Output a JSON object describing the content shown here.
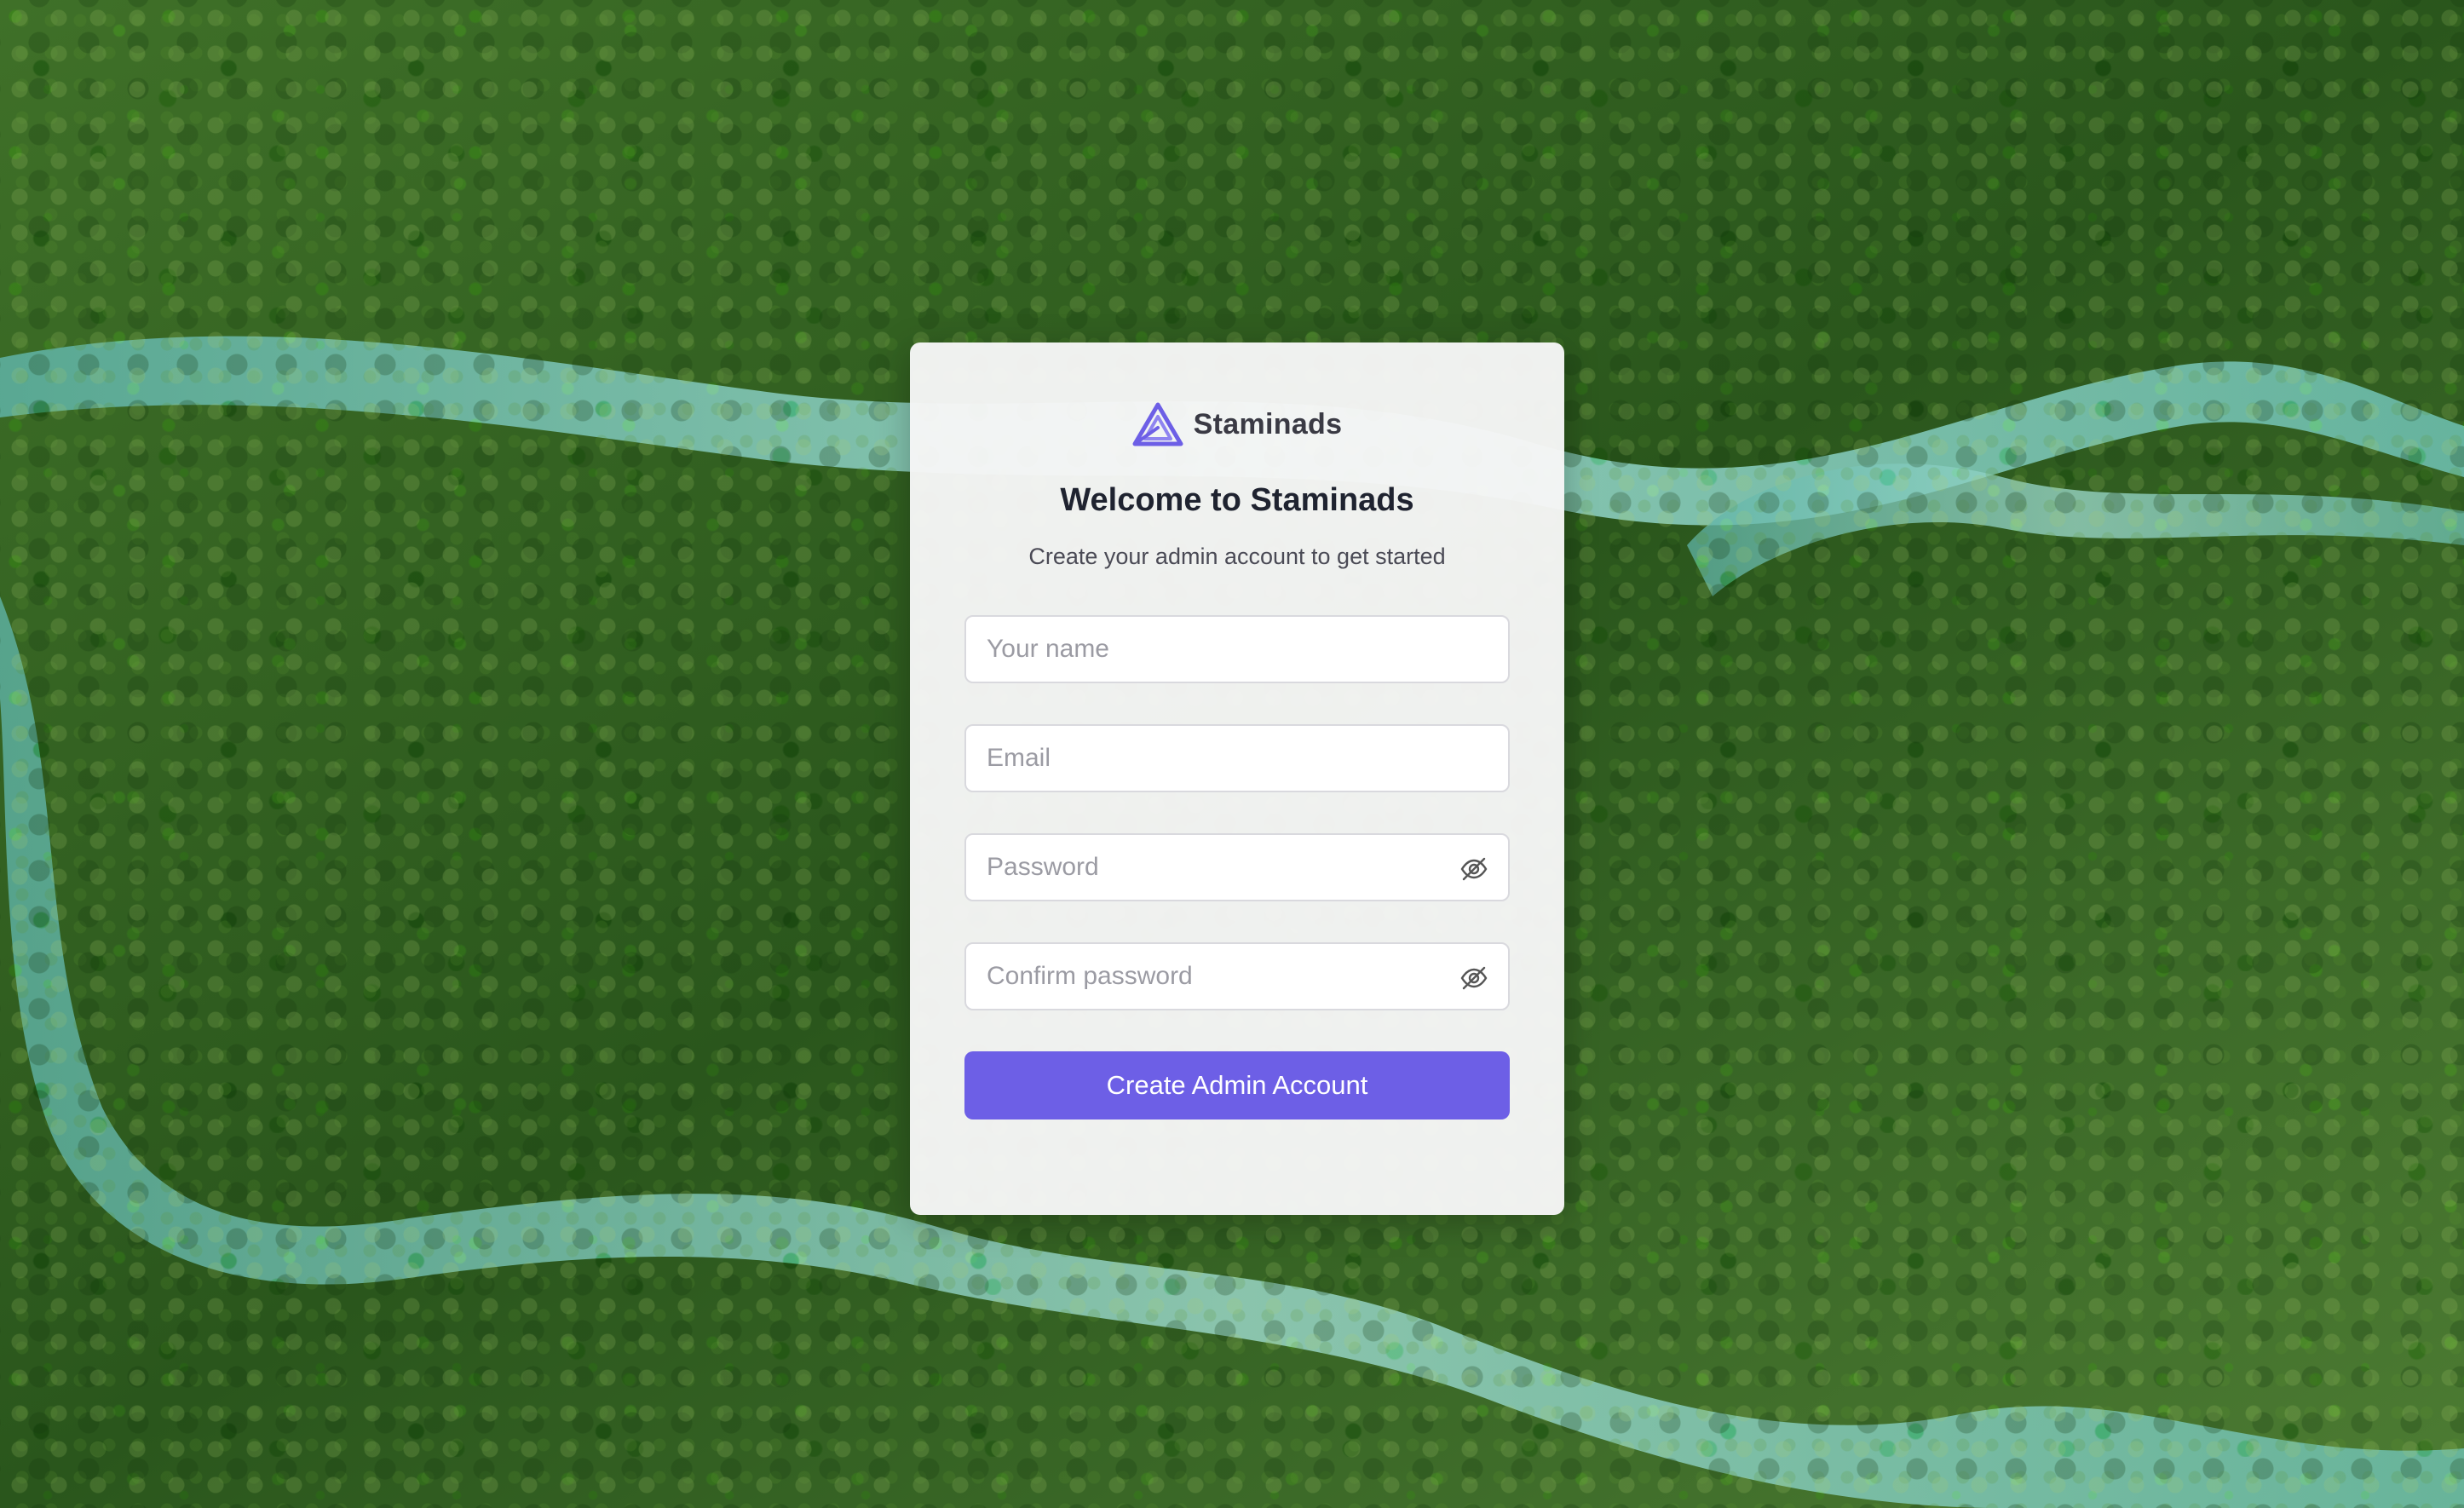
{
  "brand": {
    "name": "Staminads",
    "icon": "staminads-logo",
    "accent_color": "#6d5fe6"
  },
  "heading": {
    "title": "Welcome to Staminads",
    "subtitle": "Create your admin account to get started"
  },
  "form": {
    "name_placeholder": "Your name",
    "email_placeholder": "Email",
    "password_placeholder": "Password",
    "confirm_password_placeholder": "Confirm password",
    "password_toggle_icon": "eye-off-icon",
    "submit_label": "Create Admin Account"
  },
  "background": {
    "description_icon": "forest-river-photo",
    "forest_color": "#2f5a22",
    "river_color": "#8fd3c6"
  }
}
